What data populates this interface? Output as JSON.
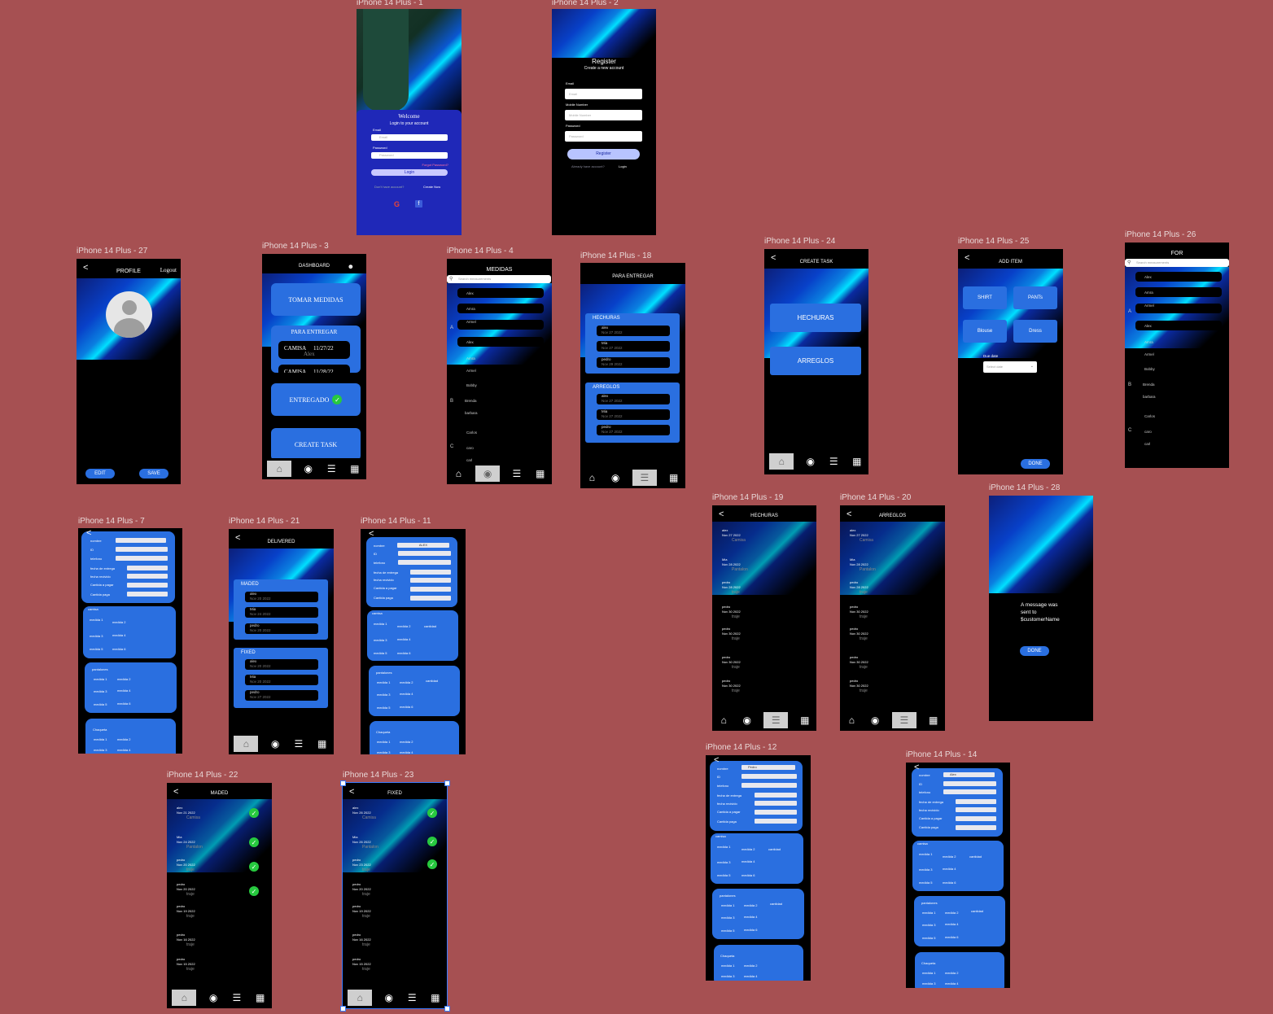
{
  "frames": {
    "f1": "iPhone 14 Plus - 1",
    "f2": "iPhone 14 Plus - 2",
    "f27": "iPhone 14 Plus - 27",
    "f3": "iPhone 14 Plus - 3",
    "f4": "iPhone 14 Plus - 4",
    "f18": "iPhone 14 Plus - 18",
    "f24": "iPhone 14 Plus - 24",
    "f25": "iPhone 14 Plus - 25",
    "f26": "iPhone 14 Plus - 26",
    "f7": "iPhone 14 Plus - 7",
    "f21": "iPhone 14 Plus - 21",
    "f11": "iPhone 14 Plus - 11",
    "f19": "iPhone 14 Plus - 19",
    "f20": "iPhone 14 Plus - 20",
    "f28": "iPhone 14 Plus - 28",
    "f22": "iPhone 14 Plus - 22",
    "f23": "iPhone 14 Plus - 23",
    "f12": "iPhone 14 Plus - 12",
    "f14": "iPhone 14 Plus - 14"
  },
  "login": {
    "welcome": "Welcome",
    "subtitle": "Login to your account",
    "email_label": "Email",
    "email_ph": "Email",
    "password_label": "Password",
    "password_ph": "Password",
    "forgot": "Forgot Password?",
    "login_btn": "Login",
    "no_account": "Don't have account?",
    "create": "Create Now"
  },
  "register": {
    "title": "Register",
    "subtitle": "Create a new account",
    "email_label": "Email",
    "email_ph": "Email",
    "mobile_label": "Mobile Number",
    "mobile_ph": "Mobile Number",
    "password_label": "Password",
    "password_ph": "Password",
    "register_btn": "Register",
    "already": "Already have account?",
    "login": "Login"
  },
  "profile": {
    "title": "PROFILE",
    "logout": "Logout",
    "edit": "EDIT",
    "save": "SAVE"
  },
  "dashboard": {
    "title": "DASHBOARD",
    "tomar": "TOMAR MEDIDAS",
    "para": "PARA ENTREGAR",
    "item1_name": "CAMISA",
    "item1_date": "11/27/22",
    "item1_person": "Alex",
    "item2_name": "CAMISA",
    "item2_date": "11/28/22",
    "entregado": "ENTREGADO",
    "create": "CREATE TASK"
  },
  "medidas": {
    "title": "MEDIDAS",
    "search_ph": "Search measurements",
    "letters": [
      "A",
      "B",
      "C"
    ],
    "names": [
      "Alex",
      "Amra",
      "Armel",
      "Alex",
      "Amra",
      "Armel",
      "Bobby",
      "Brenda",
      "barbara",
      "Carlos",
      "caro",
      "carl"
    ]
  },
  "para_entregar": {
    "title": "PARA ENTREGAR",
    "hechuras": "HECHURAS",
    "arreglos": "ARREGLOS",
    "hechuras_rows": [
      [
        "alex",
        "Nov 27 2022"
      ],
      [
        "Mia",
        "Nov 27 2022"
      ],
      [
        "pedro",
        "Nov 29 2022"
      ]
    ],
    "arreglos_rows": [
      [
        "alex",
        "Nov 27 2022"
      ],
      [
        "Mia",
        "Nov 27 2022"
      ],
      [
        "pedro",
        "Nov 27 2022"
      ]
    ]
  },
  "create_task": {
    "title": "CREATE TASK",
    "hechuras": "HECHURAS",
    "arreglos": "ARREGLOS"
  },
  "add_item": {
    "title": "ADD ITEM",
    "shirt": "SHIRT",
    "pants": "PANTs",
    "blouse": "Blouse",
    "dress": "Dress",
    "due_label": "Due date",
    "due_ph": "Select date",
    "done": "DONE"
  },
  "for_screen": {
    "title": "FOR",
    "search_ph": "Search measurements",
    "letters": [
      "A",
      "B",
      "C"
    ],
    "names": [
      "Alex",
      "Amra",
      "Armel",
      "Alex",
      "Amra",
      "Armel",
      "Bobby",
      "Brenda",
      "barbara",
      "Carlos",
      "caro",
      "carl"
    ]
  },
  "form7": {
    "fields": [
      "nombre",
      "ID",
      "telefono",
      "fecha de entrega",
      "fecha recivido",
      "Cantida a pagar",
      "Cantida paga"
    ],
    "camisa": "camisa",
    "pantalones": "pantalones",
    "chaqueta": "Chaqueta",
    "medidas": [
      "medida 1",
      "medida 2",
      "medida 3",
      "medida 4",
      "medida 5",
      "medida 6"
    ]
  },
  "delivered": {
    "title": "DELIVERED",
    "maded": "MADED",
    "fixed": "FIXED",
    "maded_rows": [
      [
        "alex",
        "Nov 20 2022"
      ],
      [
        "Mia",
        "Nov 24 2022"
      ],
      [
        "pedro",
        "Nov 20 2022"
      ]
    ],
    "fixed_rows": [
      [
        "alex",
        "Nov 20 2022"
      ],
      [
        "Mia",
        "Nov 20 2022"
      ],
      [
        "pedro",
        "Nov 27 2022"
      ]
    ]
  },
  "form11": {
    "nombre_value": "ALEX",
    "fields": [
      "nombre",
      "ID",
      "telefono",
      "fecha de entrega",
      "fecha recivido",
      "Cantida a pagar",
      "Cantida paga"
    ],
    "camisa": "camisa",
    "pantalones": "pantalones",
    "chaqueta": "Chaqueta",
    "cantidad": "cantidad",
    "medidas": [
      "medida 1",
      "medida 2",
      "medida 3",
      "medida 4",
      "medida 5",
      "medida 6"
    ]
  },
  "hechuras_list": {
    "title": "HECHURAS",
    "items": [
      [
        "alex",
        "Nov 27 2022",
        "Camisa"
      ],
      [
        "Mia",
        "Nov 28 2022",
        "Pantalon"
      ],
      [
        "pedro",
        "Nov 28 2022",
        "traje"
      ],
      [
        "pedro",
        "Nov 30 2022",
        "traje"
      ],
      [
        "pedro",
        "Nov 30 2022",
        "traje"
      ],
      [
        "pedro",
        "Nov 30 2022",
        "traje"
      ],
      [
        "pedro",
        "Nov 30 2022",
        "traje"
      ]
    ]
  },
  "arreglos_list": {
    "title": "ARREGLOS",
    "items": [
      [
        "alex",
        "Nov 27 2022",
        "Camisa"
      ],
      [
        "Mia",
        "Nov 28 2022",
        "Pantalon"
      ],
      [
        "pedro",
        "Nov 28 2022",
        "traje"
      ],
      [
        "pedro",
        "Nov 30 2022",
        "traje"
      ],
      [
        "pedro",
        "Nov 30 2022",
        "traje"
      ],
      [
        "pedro",
        "Nov 30 2022",
        "traje"
      ],
      [
        "pedro",
        "Nov 30 2022",
        "traje"
      ]
    ]
  },
  "message": {
    "text1": "A message was",
    "text2": "sent to",
    "text3": "$customerName",
    "done": "DONE"
  },
  "maded_list": {
    "title": "MADED",
    "items": [
      [
        "alex",
        "Nov 21 2022",
        "Camisa"
      ],
      [
        "Mia",
        "Nov 24 2022",
        "Pantalon"
      ],
      [
        "pedro",
        "Nov 20 2022",
        "traje"
      ],
      [
        "pedro",
        "Nov 20 2022",
        "traje"
      ],
      [
        "pedro",
        "Nov 19 2022",
        "traje"
      ],
      [
        "pedro",
        "Nov 16 2022",
        "traje"
      ],
      [
        "pedro",
        "Nov 15 2022",
        "traje"
      ]
    ]
  },
  "fixed_list": {
    "title": "FIXED",
    "items": [
      [
        "alex",
        "Nov 26 2022",
        "Camisa"
      ],
      [
        "Mia",
        "Nov 26 2022",
        "Pantalon"
      ],
      [
        "pedro",
        "Nov 23 2022",
        "traje"
      ],
      [
        "pedro",
        "Nov 20 2022",
        "traje"
      ],
      [
        "pedro",
        "Nov 19 2022",
        "traje"
      ],
      [
        "pedro",
        "Nov 16 2022",
        "traje"
      ],
      [
        "pedro",
        "Nov 15 2022",
        "traje"
      ]
    ]
  },
  "form12": {
    "nombre_value": "Pedro"
  },
  "form14": {
    "nombre_value": "Alex"
  },
  "colors": {
    "background": "#a65052",
    "accent": "#2a6fe0",
    "check": "#27c93f"
  },
  "icons": [
    "home-icon",
    "measure-tape-icon",
    "checklist-icon",
    "calendar-icon",
    "google-icon",
    "facebook-icon",
    "back-icon",
    "user-icon",
    "search-icon"
  ]
}
